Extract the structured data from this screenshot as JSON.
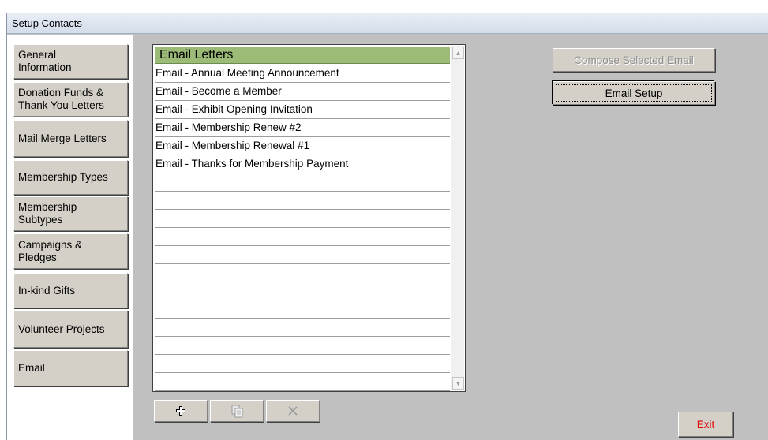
{
  "window": {
    "title": "Setup Contacts"
  },
  "sidebar": {
    "items": [
      {
        "label": "General\nInformation"
      },
      {
        "label": "Donation Funds &\nThank You Letters"
      },
      {
        "label": "Mail Merge Letters"
      },
      {
        "label": "Membership Types"
      },
      {
        "label": "Membership\nSubtypes"
      },
      {
        "label": "Campaigns &\nPledges"
      },
      {
        "label": "In-kind Gifts"
      },
      {
        "label": "Volunteer Projects"
      },
      {
        "label": "Email"
      }
    ]
  },
  "list": {
    "header": "Email Letters",
    "rows": [
      "Email - Annual Meeting Announcement",
      "Email - Become a Member",
      "Email - Exhibit Opening Invitation",
      "Email - Membership Renew #2",
      "Email - Membership Renewal #1",
      "Email - Thanks for Membership Payment",
      "",
      "",
      "",
      "",
      "",
      "",
      "",
      "",
      "",
      "",
      "",
      ""
    ]
  },
  "toolbar": {
    "add_icon": "plus-icon",
    "copy_icon": "copy-document-icon",
    "delete_icon": "delete-x-icon"
  },
  "actions": {
    "compose_label": "Compose Selected Email",
    "compose_enabled": false,
    "setup_label": "Email Setup",
    "exit_label": "Exit"
  },
  "colors": {
    "list_header": "#9bbb77",
    "exit_text": "#e00000",
    "window_bg": "#c0c0c0"
  }
}
